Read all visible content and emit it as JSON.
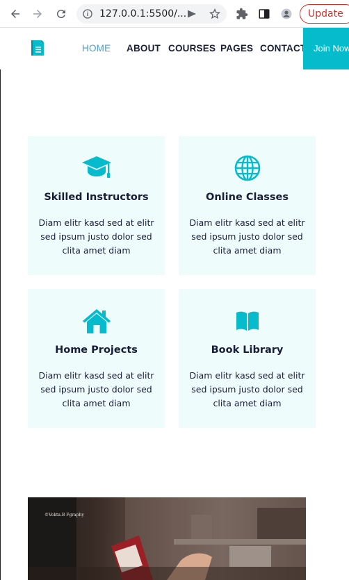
{
  "browser": {
    "url": "127.0.0.1:5500/...",
    "update_label": "Update"
  },
  "nav": {
    "items": [
      "HOME",
      "ABOUT",
      "COURSES",
      "PAGES",
      "CONTACT"
    ],
    "join_label": "Join Now"
  },
  "services": [
    {
      "icon": "graduation-cap-icon",
      "title": "Skilled Instructors",
      "text": "Diam elitr kasd sed at elitr sed ipsum justo dolor sed clita amet diam"
    },
    {
      "icon": "globe-icon",
      "title": "Online Classes",
      "text": "Diam elitr kasd sed at elitr sed ipsum justo dolor sed clita amet diam"
    },
    {
      "icon": "home-icon",
      "title": "Home Projects",
      "text": "Diam elitr kasd sed at elitr sed ipsum justo dolor sed clita amet diam"
    },
    {
      "icon": "book-open-icon",
      "title": "Book Library",
      "text": "Diam elitr kasd sed at elitr sed ipsum justo dolor sed clita amet diam"
    }
  ],
  "photo": {
    "credit": "©Vekta.B Fgraphy"
  },
  "colors": {
    "accent": "#06bbcc",
    "card_bg": "#eefcfc",
    "heading": "#181d38",
    "nav_active": "#4aa0cf"
  }
}
